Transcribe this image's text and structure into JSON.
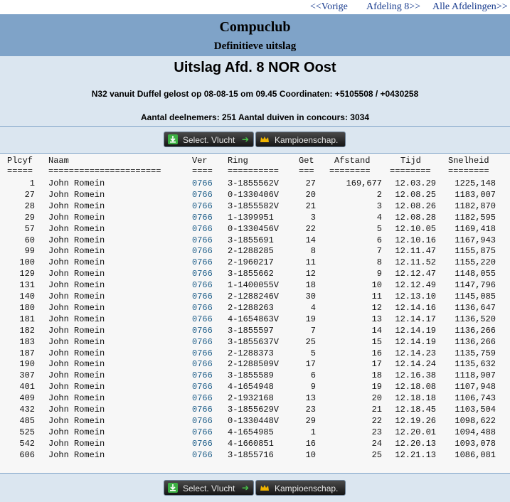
{
  "nav": {
    "prev": "<<Vorige",
    "afdeling": "Afdeling 8>>",
    "alle": "Alle Afdelingen>>"
  },
  "header": {
    "club": "Compuclub",
    "subtitle": "Definitieve uitslag"
  },
  "race": {
    "title": "Uitslag Afd. 8 NOR Oost",
    "info": "N32 vanuit Duffel gelost op 08-08-15 om 09.45 Coordinaten: +5105508 / +0430258",
    "participants": "Aantal deelnemers: 251 Aantal duiven in concours: 3034"
  },
  "buttons": {
    "select": "Select. Vlucht",
    "kampioen": "Kampioenschap."
  },
  "table": {
    "headers": [
      "Plcyf",
      "Naam",
      "Ver",
      "Ring",
      "Get",
      "Afstand",
      "Tijd",
      "Snelheid"
    ],
    "underlines": [
      "=====",
      "======================",
      "====",
      "==========",
      "===",
      "========",
      "========",
      "========"
    ],
    "rows": [
      [
        "1",
        "John Romein",
        "0766",
        "3-1855562V",
        "27",
        "169,677",
        "12.03.29",
        "1225,148"
      ],
      [
        "27",
        "John Romein",
        "0766",
        "0-1330406V",
        "20",
        "2",
        "12.08.25",
        "1183,007"
      ],
      [
        "28",
        "John Romein",
        "0766",
        "3-1855582V",
        "21",
        "3",
        "12.08.26",
        "1182,870"
      ],
      [
        "29",
        "John Romein",
        "0766",
        "1-1399951",
        "3",
        "4",
        "12.08.28",
        "1182,595"
      ],
      [
        "57",
        "John Romein",
        "0766",
        "0-1330456V",
        "22",
        "5",
        "12.10.05",
        "1169,418"
      ],
      [
        "60",
        "John Romein",
        "0766",
        "3-1855691",
        "14",
        "6",
        "12.10.16",
        "1167,943"
      ],
      [
        "99",
        "John Romein",
        "0766",
        "2-1288285",
        "8",
        "7",
        "12.11.47",
        "1155,875"
      ],
      [
        "100",
        "John Romein",
        "0766",
        "2-1960217",
        "11",
        "8",
        "12.11.52",
        "1155,220"
      ],
      [
        "129",
        "John Romein",
        "0766",
        "3-1855662",
        "12",
        "9",
        "12.12.47",
        "1148,055"
      ],
      [
        "131",
        "John Romein",
        "0766",
        "1-1400055V",
        "18",
        "10",
        "12.12.49",
        "1147,796"
      ],
      [
        "140",
        "John Romein",
        "0766",
        "2-1288246V",
        "30",
        "11",
        "12.13.10",
        "1145,085"
      ],
      [
        "180",
        "John Romein",
        "0766",
        "2-1288263",
        "4",
        "12",
        "12.14.16",
        "1136,647"
      ],
      [
        "181",
        "John Romein",
        "0766",
        "4-1654863V",
        "19",
        "13",
        "12.14.17",
        "1136,520"
      ],
      [
        "182",
        "John Romein",
        "0766",
        "3-1855597",
        "7",
        "14",
        "12.14.19",
        "1136,266"
      ],
      [
        "183",
        "John Romein",
        "0766",
        "3-1855637V",
        "25",
        "15",
        "12.14.19",
        "1136,266"
      ],
      [
        "187",
        "John Romein",
        "0766",
        "2-1288373",
        "5",
        "16",
        "12.14.23",
        "1135,759"
      ],
      [
        "190",
        "John Romein",
        "0766",
        "2-1288509V",
        "17",
        "17",
        "12.14.24",
        "1135,632"
      ],
      [
        "307",
        "John Romein",
        "0766",
        "3-1855589",
        "6",
        "18",
        "12.16.38",
        "1118,907"
      ],
      [
        "401",
        "John Romein",
        "0766",
        "4-1654948",
        "9",
        "19",
        "12.18.08",
        "1107,948"
      ],
      [
        "409",
        "John Romein",
        "0766",
        "2-1932168",
        "13",
        "20",
        "12.18.18",
        "1106,743"
      ],
      [
        "432",
        "John Romein",
        "0766",
        "3-1855629V",
        "23",
        "21",
        "12.18.45",
        "1103,504"
      ],
      [
        "485",
        "John Romein",
        "0766",
        "0-1330448V",
        "29",
        "22",
        "12.19.26",
        "1098,622"
      ],
      [
        "525",
        "John Romein",
        "0766",
        "4-1654985",
        "1",
        "23",
        "12.20.01",
        "1094,488"
      ],
      [
        "542",
        "John Romein",
        "0766",
        "4-1660851",
        "16",
        "24",
        "12.20.13",
        "1093,078"
      ],
      [
        "606",
        "John Romein",
        "0766",
        "3-1855716",
        "10",
        "25",
        "12.21.13",
        "1086,081"
      ]
    ]
  },
  "colors": {
    "band": "#7fa3c8",
    "background": "#dbe6f0",
    "link": "#1a3d8f",
    "ver_link": "#1f5f8a"
  },
  "icons": {
    "select": "download-arrow-icon",
    "kampioen": "crown-icon",
    "arrow": "arrow-right-icon"
  }
}
